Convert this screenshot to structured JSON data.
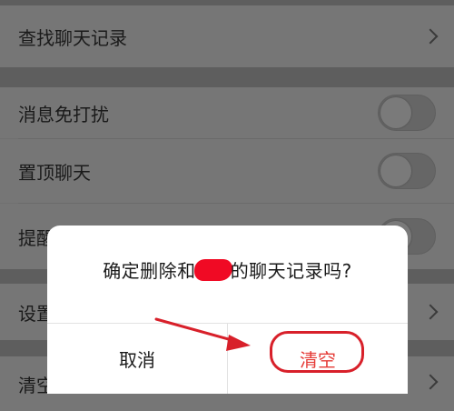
{
  "settings": {
    "rows": [
      {
        "label": "查找聊天记录"
      },
      {
        "label": "消息免打扰"
      },
      {
        "label": "置顶聊天"
      },
      {
        "label": "提醒"
      },
      {
        "label": "设置"
      },
      {
        "label": "清空聊天记录"
      }
    ]
  },
  "dialog": {
    "message_before": "确定删除和",
    "message_after": "的聊天记录吗?",
    "cancel_label": "取消",
    "confirm_label": "清空"
  },
  "annotation": {
    "color": "#d8202a"
  }
}
